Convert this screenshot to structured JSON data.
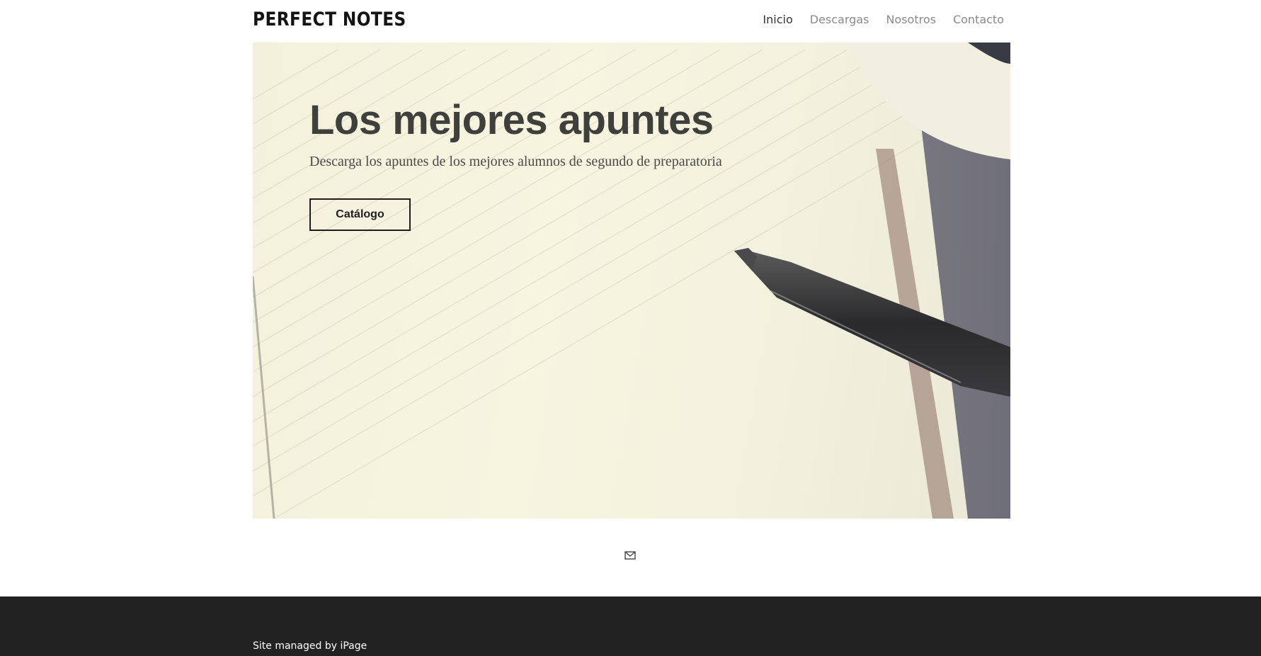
{
  "header": {
    "logo": "PERFECT NOTES",
    "nav": [
      {
        "label": "Inicio",
        "active": true
      },
      {
        "label": "Descargas",
        "active": false
      },
      {
        "label": "Nosotros",
        "active": false
      },
      {
        "label": "Contacto",
        "active": false
      }
    ]
  },
  "hero": {
    "title": "Los mejores apuntes",
    "subtitle": "Descarga los apuntes de los mejores alumnos de segundo de preparatoria",
    "button_label": "Catálogo"
  },
  "social": {
    "icon": "mail-icon"
  },
  "footer": {
    "text_prefix": "Site managed by ",
    "link_label": "iPage"
  },
  "colors": {
    "footer_bg": "#222222",
    "text_dark": "#3f3f3c",
    "nav_inactive": "#8a8a8a"
  }
}
